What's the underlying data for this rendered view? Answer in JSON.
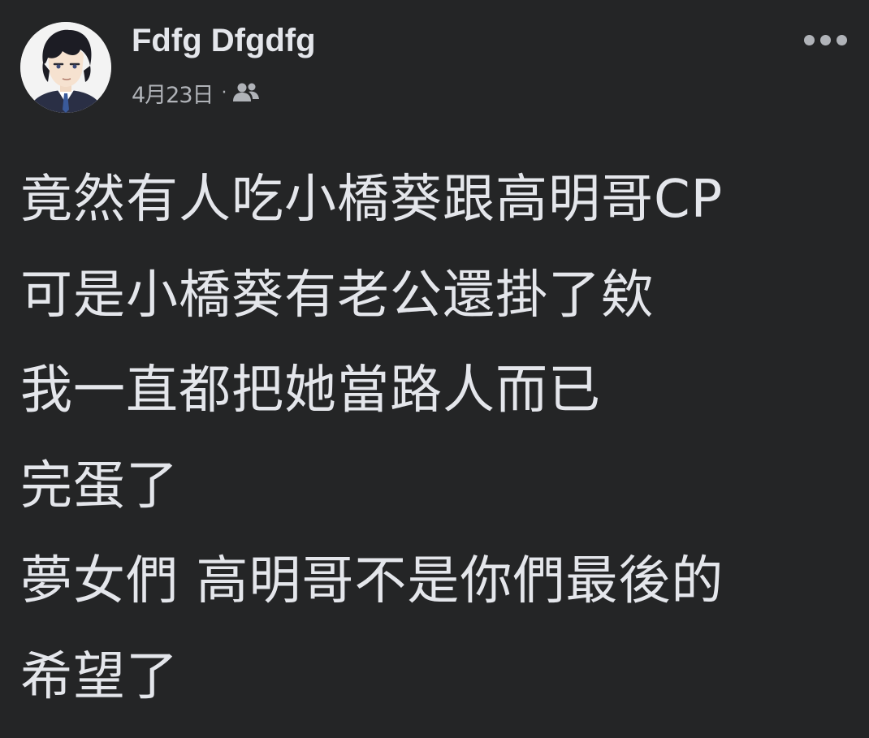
{
  "post": {
    "author": {
      "name": "Fdfg Dfgdfg",
      "avatar": "anime-character-avatar"
    },
    "meta": {
      "date": "4月23日",
      "separator": "·",
      "audience_icon": "friends-icon"
    },
    "more_icon": "more-horizontal-icon",
    "lines": [
      "竟然有人吃小橋葵跟高明哥CP",
      "可是小橋葵有老公還掛了欸",
      "我一直都把她當路人而已",
      "完蛋了",
      "夢女們 高明哥不是你們最後的",
      "希望了"
    ]
  },
  "colors": {
    "background": "#242526",
    "primary_text": "#e4e6eb",
    "secondary_text": "#b0b3b8"
  }
}
